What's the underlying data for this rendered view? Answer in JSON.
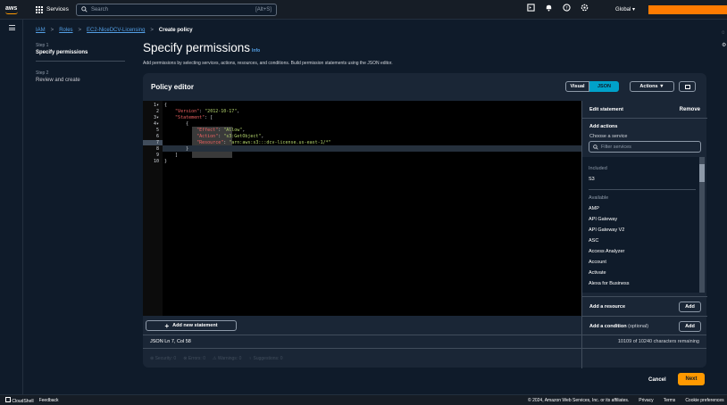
{
  "topbar": {
    "logo": "aws",
    "services_label": "Services",
    "search_placeholder": "Search",
    "search_shortcut": "[Alt+S]",
    "region": "Global ▾"
  },
  "breadcrumb": [
    "IAM",
    "Roles",
    "EC2-NiceDCV-Licensing",
    "Create policy"
  ],
  "steps": [
    {
      "number": "Step 1",
      "title": "Specify permissions"
    },
    {
      "number": "Step 2",
      "title": "Review and create"
    }
  ],
  "page": {
    "title": "Specify permissions",
    "info": "Info",
    "description": "Add permissions by selecting services, actions, resources, and conditions. Build permission statements using the JSON editor."
  },
  "editor": {
    "title": "Policy editor",
    "visual_label": "Visual",
    "json_label": "JSON",
    "actions_label": "Actions ▼",
    "lines": [
      {
        "n": "1",
        "fold": true
      },
      {
        "n": "2",
        "fold": false
      },
      {
        "n": "3",
        "fold": true
      },
      {
        "n": "4",
        "fold": true
      },
      {
        "n": "5",
        "fold": false
      },
      {
        "n": "6",
        "fold": false
      },
      {
        "n": "7",
        "fold": false
      },
      {
        "n": "8",
        "fold": false
      },
      {
        "n": "9",
        "fold": false
      },
      {
        "n": "10",
        "fold": false
      }
    ],
    "code": {
      "l1": "{",
      "l2_key": "\"Version\"",
      "l2_val": "\"2012-10-17\"",
      "l3_key": "\"Statement\"",
      "l3_rest": ": [",
      "l4": "{",
      "l5_key": "\"Effect\"",
      "l5_val": "\"Allow\"",
      "l6_key": "\"Action\"",
      "l6_val": "\"s3:GetObject\"",
      "l7_key": "\"Resource\"",
      "l7_val": "\"arn:aws:s3:::dcv-license.us-east-1/*\"",
      "l8": "}",
      "l9": "]",
      "l10": "}"
    },
    "add_statement_label": "Add new statement",
    "status_left": "JSON  Ln 7, Col 58",
    "status_right": "10109 of 10240 characters remaining",
    "lint": [
      "Security: 0",
      "Errors: 0",
      "Warnings: 0",
      "Suggestions: 0"
    ]
  },
  "side_panel": {
    "title": "Edit statement",
    "remove_label": "Remove",
    "add_actions": "Add actions",
    "choose_service": "Choose a service",
    "filter_placeholder": "Filter services",
    "included_label": "Included",
    "included": [
      "S3"
    ],
    "available_label": "Available",
    "available": [
      "AMP",
      "API Gateway",
      "API Gateway V2",
      "ASC",
      "Access Analyzer",
      "Account",
      "Activate",
      "Alexa for Business"
    ],
    "add_resource": "Add a resource",
    "add_condition": "Add a condition",
    "optional": "(optional)",
    "add_label": "Add"
  },
  "footer_actions": {
    "cancel": "Cancel",
    "next": "Next"
  },
  "footer": {
    "cloudshell": "CloudShell",
    "feedback": "Feedback",
    "copyright": "© 2024, Amazon Web Services, Inc. or its affiliates.",
    "privacy": "Privacy",
    "terms": "Terms",
    "cookie": "Cookie preferences"
  }
}
